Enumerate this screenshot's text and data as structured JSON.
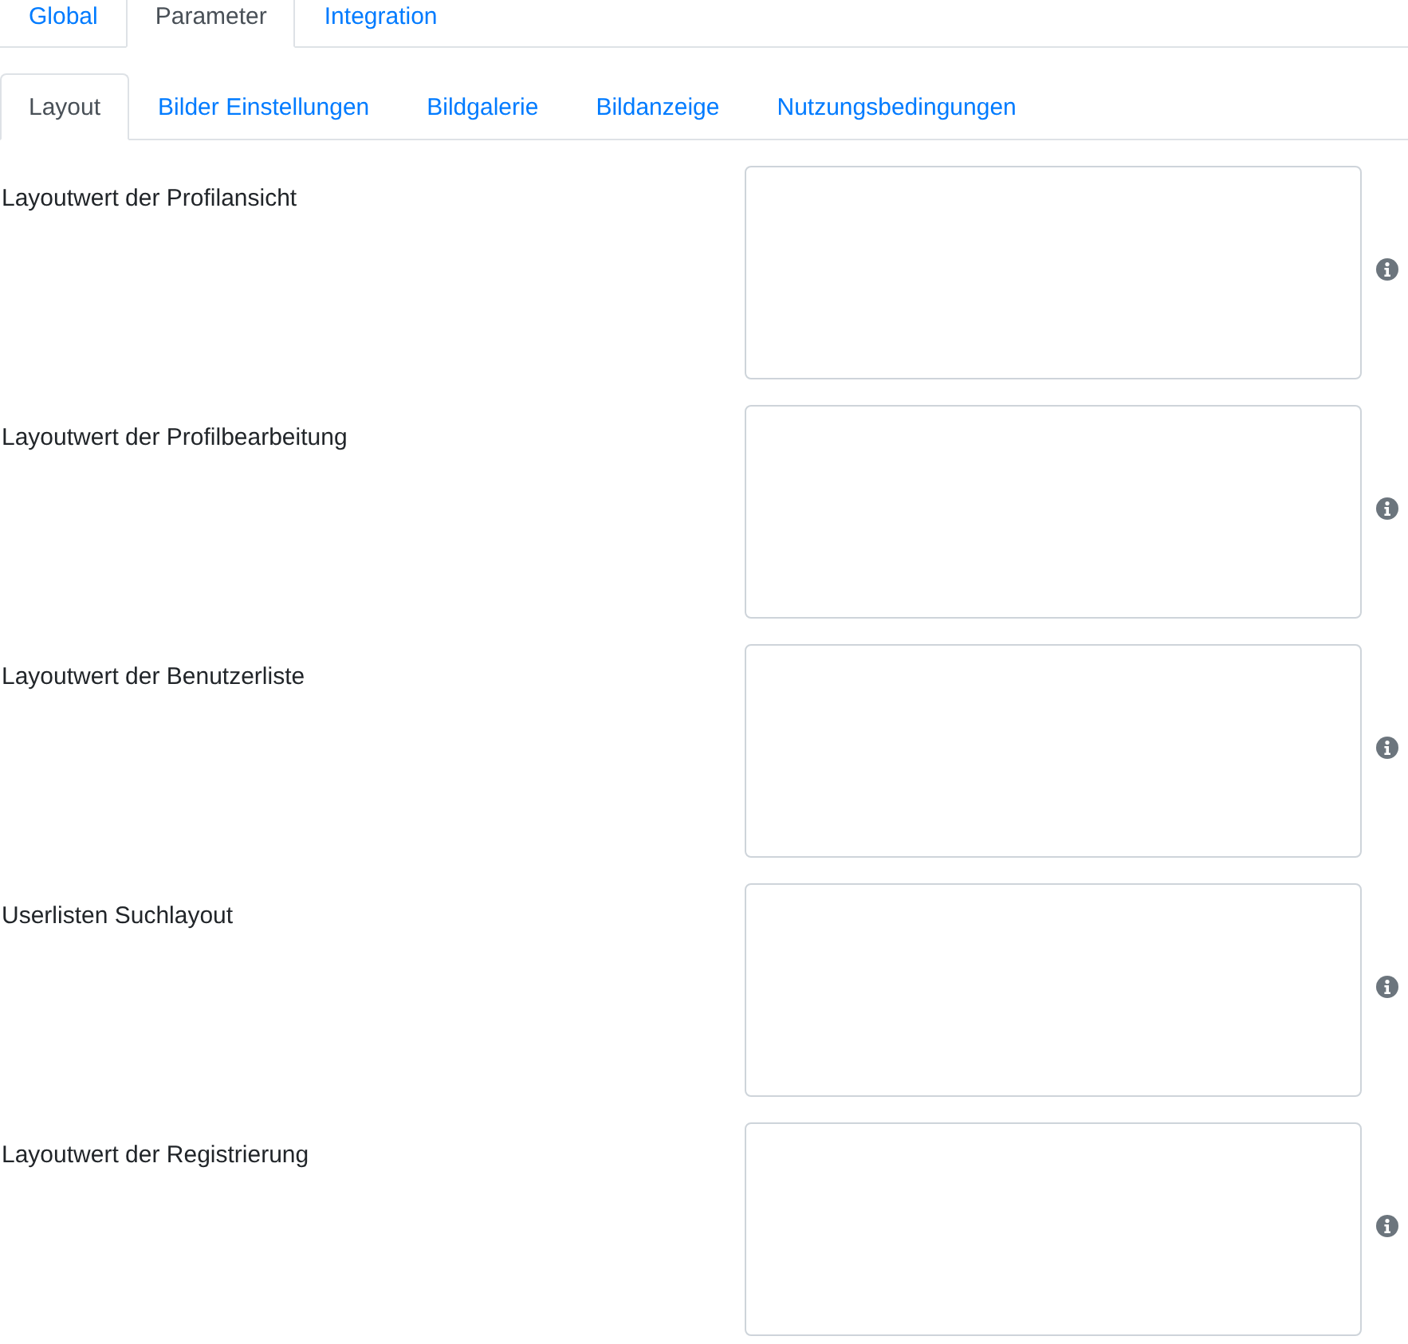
{
  "main_tabs": [
    {
      "label": "Global",
      "selected": false
    },
    {
      "label": "Parameter",
      "selected": true
    },
    {
      "label": "Integration",
      "selected": false
    }
  ],
  "sub_tabs": [
    {
      "label": "Layout",
      "selected": true
    },
    {
      "label": "Bilder Einstellungen",
      "selected": false
    },
    {
      "label": "Bildgalerie",
      "selected": false
    },
    {
      "label": "Bildanzeige",
      "selected": false
    },
    {
      "label": "Nutzungsbedingungen",
      "selected": false
    }
  ],
  "fields": [
    {
      "label": "Layoutwert der Profilansicht"
    },
    {
      "label": "Layoutwert der Profilbearbeitung"
    },
    {
      "label": "Layoutwert der Benutzerliste"
    },
    {
      "label": "Userlisten Suchlayout"
    },
    {
      "label": "Layoutwert der Registrierung"
    }
  ]
}
